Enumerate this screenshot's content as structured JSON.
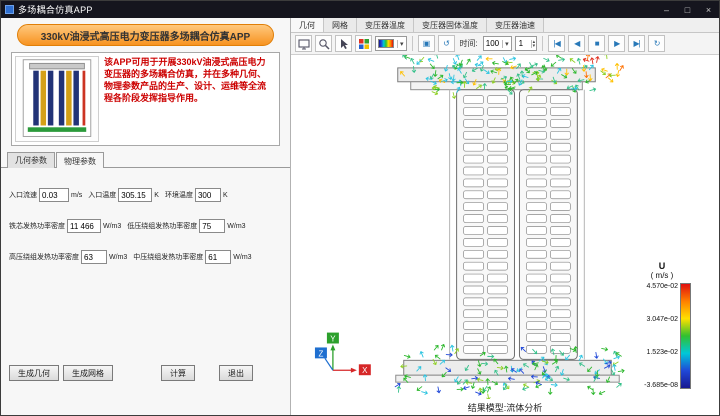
{
  "window": {
    "title": "多场耦合仿真APP",
    "minimize": "–",
    "maximize": "□",
    "close": "×"
  },
  "left_panel": {
    "banner": "330kV油浸式高压电力变压器多场耦合仿真APP",
    "description": "该APP可用于开展330kV油浸式高压电力变压器的多场耦合仿真，并在多种几何、物理参数产品的生产、设计、运维等全流程各阶段发挥指导作用。",
    "tabs": [
      {
        "label": "几何参数"
      },
      {
        "label": "物理参数"
      }
    ],
    "fields": [
      {
        "label": "入口流速",
        "value": "0.03",
        "unit": "m/s"
      },
      {
        "label": "入口温度",
        "value": "305.15",
        "unit": "K"
      },
      {
        "label": "环境温度",
        "value": "300",
        "unit": "K"
      },
      {
        "label": "铁芯发热功率密度",
        "value": "11 466",
        "unit": "W/m3"
      },
      {
        "label": "低压绕组发热功率密度",
        "value": "75",
        "unit": "W/m3"
      },
      {
        "label": "高压绕组发热功率密度",
        "value": "63",
        "unit": "W/m3"
      },
      {
        "label": "中压绕组发热功率密度",
        "value": "61",
        "unit": "W/m3"
      }
    ],
    "buttons": [
      "生成几何",
      "生成网格",
      "计算",
      "退出"
    ]
  },
  "right_panel": {
    "tabs": [
      "几何",
      "网格",
      "变压器温度",
      "变压器固体温度",
      "变压器油速"
    ],
    "toolbar": {
      "time_label": "时间:",
      "zoom_value": "100",
      "frame_value": "1"
    },
    "status": "结果模型:流体分析",
    "colorbar": {
      "title": "U",
      "unit": "( m/s )",
      "ticks": [
        "4.570e-02",
        "3.047e-02",
        "1.523e-02",
        "-3.685e-08"
      ]
    },
    "axes": {
      "x": "X",
      "y": "Y",
      "z": "Z"
    }
  },
  "icons": {
    "caret_down": "▾",
    "spin_up": "▴",
    "spin_down": "▾",
    "fit_view": "▣",
    "reset_view": "↺",
    "first_frame": "|◀",
    "prev_frame": "◀",
    "stop": "■",
    "play": "▶",
    "last_frame": "▶|",
    "loop": "↻"
  },
  "colors": {
    "titlebar": "#15151e",
    "banner_orange": "#f79321",
    "description_red": "#cc0000",
    "toolbar_blue": "#2878b8",
    "colorbar_colors": [
      "#e01010",
      "#ff8000",
      "#ffe000",
      "#30c030",
      "#00c8d8",
      "#2048d8",
      "#181890"
    ],
    "flow_colors": [
      "#2db82d",
      "#35c08a",
      "#2cc4e0",
      "#8fd024",
      "#ffc000",
      "#ff7000",
      "#e03020",
      "#2048d8"
    ]
  }
}
